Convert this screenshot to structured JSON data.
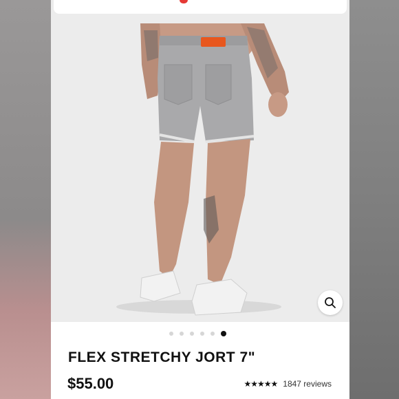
{
  "product": {
    "title": "FLEX STRETCHY JORT 7\"",
    "price": "$55.00",
    "rating_stars": "★★★★★",
    "rating_value": 5,
    "reviews": "1847 reviews"
  },
  "gallery": {
    "image_count": 6,
    "active_index": 5
  },
  "icons": {
    "zoom": "magnifier-icon"
  },
  "colors": {
    "accent": "#e53935",
    "text": "#111111",
    "image_bg": "#ececec"
  }
}
